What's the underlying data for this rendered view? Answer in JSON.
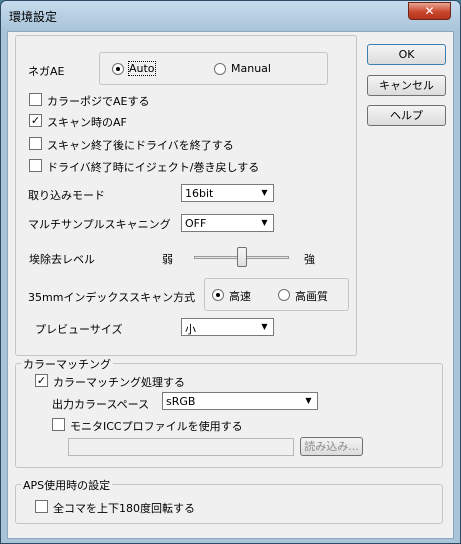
{
  "window": {
    "title": "環境設定",
    "close_label": "✕"
  },
  "buttons": {
    "ok": "OK",
    "cancel": "キャンセル",
    "help": "ヘルプ"
  },
  "nega_ae": {
    "label": "ネガAE",
    "options": [
      "Auto",
      "Manual"
    ],
    "selected": "Auto"
  },
  "checkboxes": [
    {
      "label": "カラーポジでAEする",
      "checked": false
    },
    {
      "label": "スキャン時のAF",
      "checked": true
    },
    {
      "label": "スキャン終了後にドライバを終了する",
      "checked": false
    },
    {
      "label": "ドライバ終了時にイジェクト/巻き戻しする",
      "checked": false
    }
  ],
  "capture_mode": {
    "label": "取り込みモード",
    "value": "16bit"
  },
  "multisample": {
    "label": "マルチサンプルスキャニング",
    "value": "OFF"
  },
  "dust_removal": {
    "label": "埃除去レベル",
    "min_label": "弱",
    "max_label": "強",
    "level": 0.5
  },
  "index_scan": {
    "label": "35mmインデックススキャン方式",
    "options": [
      "高速",
      "高画質"
    ],
    "selected": "高速"
  },
  "preview_size": {
    "label": "プレビューサイズ",
    "value": "小"
  },
  "color_matching": {
    "group_title": "カラーマッチング",
    "enable_label": "カラーマッチング処理する",
    "enable_checked": true,
    "output_space_label": "出力カラースペース",
    "output_space_value": "sRGB",
    "monitor_icc_label": "モニタICCプロファイルを使用する",
    "monitor_icc_checked": false,
    "profile_path": "",
    "load_button": "読み込み..."
  },
  "aps": {
    "group_title": "APS使用時の設定",
    "rotate_label": "全コマを上下180度回転する",
    "rotate_checked": false
  },
  "check_glyph": "✓"
}
